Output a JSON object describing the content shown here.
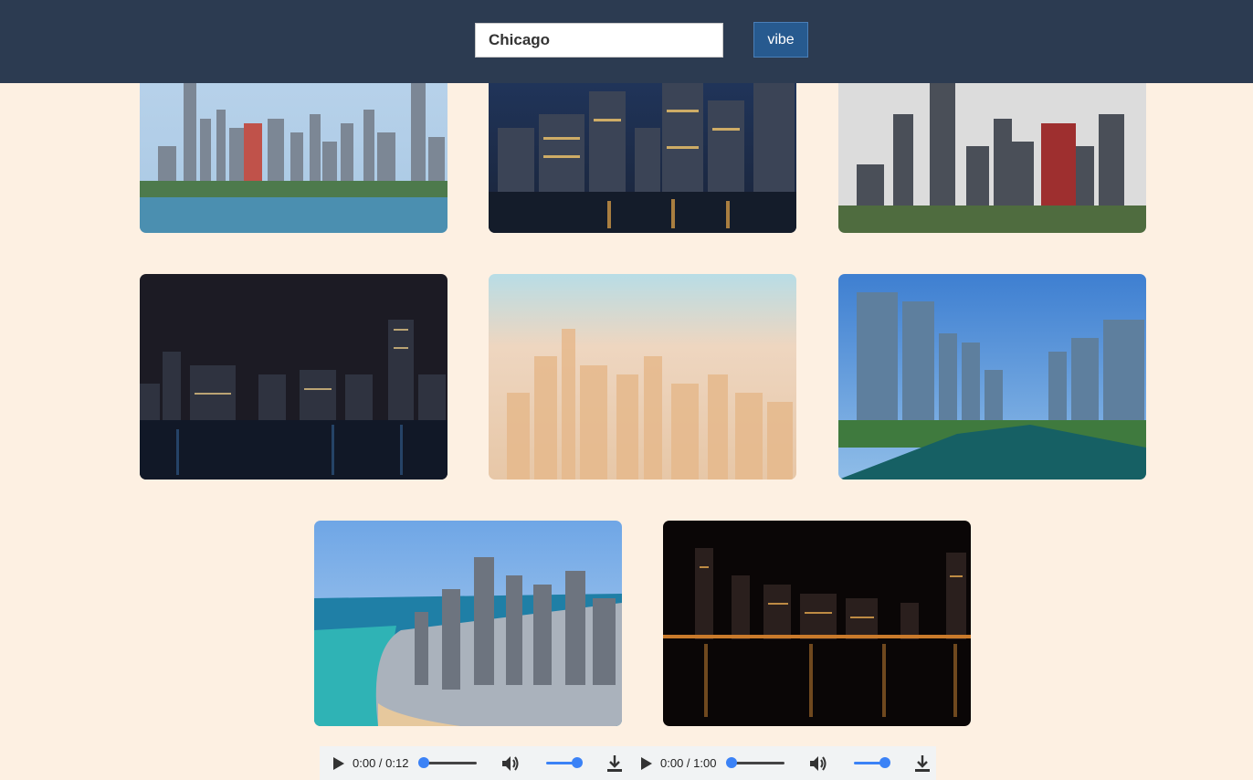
{
  "search": {
    "value": "Chicago",
    "placeholder": ""
  },
  "vibe_button": {
    "label": "vibe"
  },
  "gallery": [
    {
      "name": "chicago-skyline-day-lake",
      "theme": "day-skyline"
    },
    {
      "name": "chicago-river-night-hdr",
      "theme": "night-river"
    },
    {
      "name": "chicago-skyline-willis-cloudy",
      "theme": "cloudy-skyline"
    },
    {
      "name": "chicago-skyline-night-reflection",
      "theme": "night-lake"
    },
    {
      "name": "chicago-aerial-hazy",
      "theme": "hazy-aerial"
    },
    {
      "name": "chicago-river-towers-day",
      "theme": "river-towers"
    },
    {
      "name": "chicago-lakefront-aerial",
      "theme": "lakefront"
    },
    {
      "name": "chicago-skyline-night-lake",
      "theme": "night-lake-2"
    }
  ],
  "audio": [
    {
      "time": "0:00 / 0:12",
      "progress": 0,
      "volume": 1
    },
    {
      "time": "0:00 / 1:00",
      "progress": 0,
      "volume": 1
    }
  ],
  "colors": {
    "header_bg": "#2c3b51",
    "page_bg": "#fdf0e2",
    "button_bg": "#275a8f",
    "accent": "#3b82f6"
  },
  "icons": {
    "play": "play-icon",
    "volume": "volume-icon",
    "download": "download-icon"
  }
}
